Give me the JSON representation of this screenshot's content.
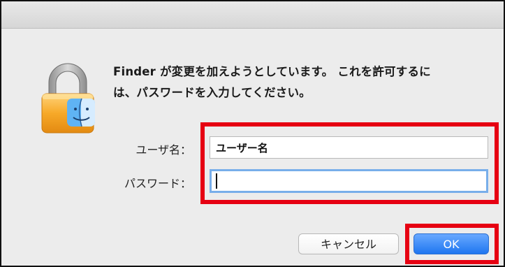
{
  "dialog": {
    "message_line1": "Finder が変更を加えようとしています。 これを許可するに",
    "message_line2": "は、パスワードを入力してください。"
  },
  "form": {
    "username_label": "ユーザ名：",
    "username_value": "ユーザー名",
    "password_label": "パスワード：",
    "password_value": ""
  },
  "buttons": {
    "cancel_label": "キャンセル",
    "ok_label": "OK"
  },
  "colors": {
    "highlight": "#e60012",
    "accent": "#1e76f0",
    "focus_ring": "#78aeea"
  },
  "icons": {
    "lock": "padlock-icon",
    "finder": "finder-icon"
  }
}
